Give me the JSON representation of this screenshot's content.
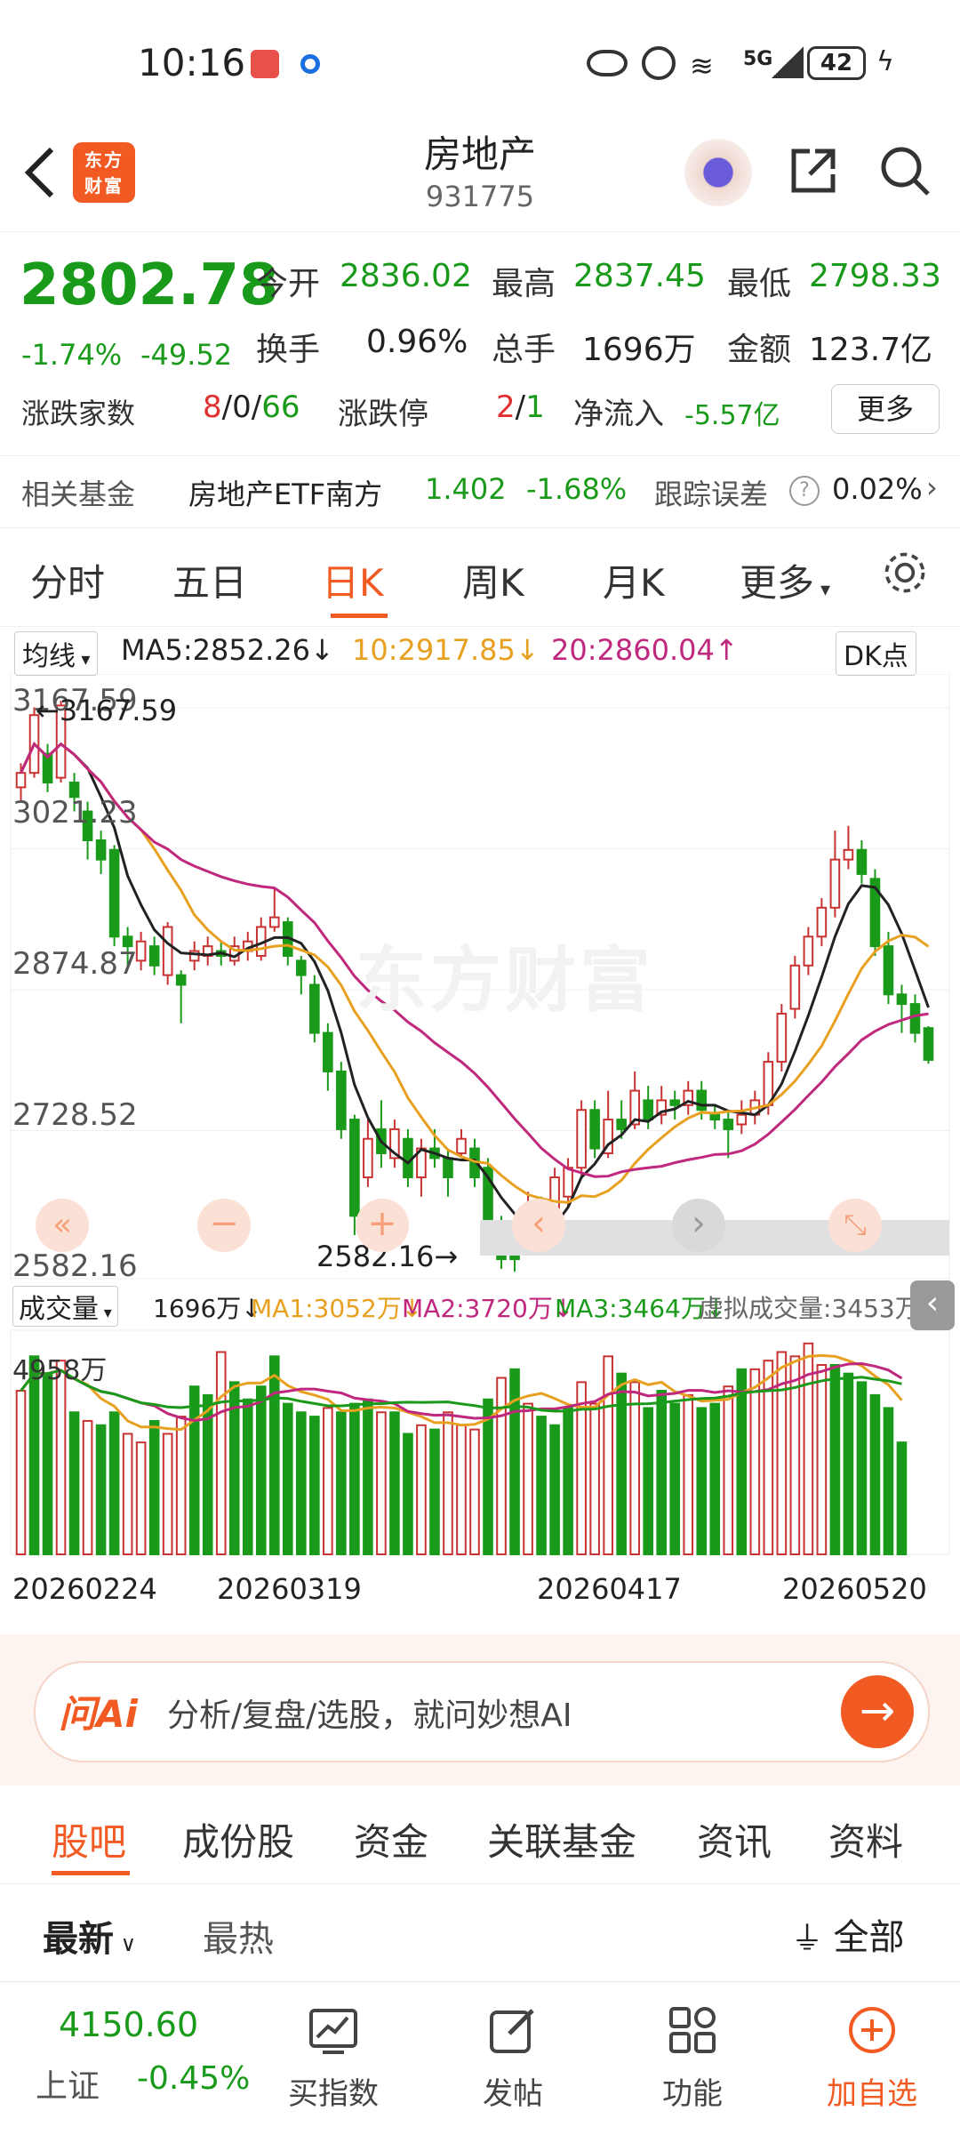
{
  "status": {
    "time": "10:16",
    "battery": "42",
    "network": "5G"
  },
  "header": {
    "title": "房地产",
    "code": "931775",
    "logo": "东方财富"
  },
  "quote": {
    "price": "2802.78",
    "change_pct": "-1.74%",
    "change": "-49.52",
    "open_label": "今开",
    "open": "2836.02",
    "high_label": "最高",
    "high": "2837.45",
    "low_label": "最低",
    "low": "2798.33",
    "turnover_label": "换手",
    "turnover": "0.96%",
    "volume_label": "总手",
    "volume": "1696万",
    "amount_label": "金额",
    "amount": "123.7亿",
    "updown_label": "涨跌家数",
    "up": "8",
    "flat": "0",
    "down": "66",
    "limit_label": "涨跌停",
    "limit_up": "2",
    "limit_down": "1",
    "inflow_label": "净流入",
    "inflow": "-5.57亿",
    "more": "更多"
  },
  "fund": {
    "label": "相关基金",
    "name": "房地产ETF南方",
    "price": "1.402",
    "pct": "-1.68%",
    "err_label": "跟踪误差",
    "err": "0.02%"
  },
  "period_tabs": [
    "分时",
    "五日",
    "日K",
    "周K",
    "月K",
    "更多"
  ],
  "active_period": "日K",
  "ma": {
    "select": "均线",
    "ma5": "MA5:2852.26",
    "ma10": "10:2917.85",
    "ma20": "20:2860.04",
    "dk": "DK点",
    "c5": "#222222",
    "c10": "#e8a020",
    "c20": "#c0287e"
  },
  "chart_data": {
    "type": "candlestick",
    "y_ticks": [
      "3167.59",
      "3021.23",
      "2874.87",
      "2728.52",
      "2582.16"
    ],
    "ylim": [
      2582.16,
      3167.59
    ],
    "max_label": "3167.59",
    "min_label": "2582.16",
    "watermark": "东方财富",
    "candles": [
      {
        "o": 3085,
        "c": 3100,
        "h": 3110,
        "l": 3070
      },
      {
        "o": 3100,
        "c": 3160,
        "h": 3168,
        "l": 3095
      },
      {
        "o": 3120,
        "c": 3090,
        "h": 3130,
        "l": 3080
      },
      {
        "o": 3095,
        "c": 3170,
        "h": 3175,
        "l": 3090
      },
      {
        "o": 3090,
        "c": 3075,
        "h": 3100,
        "l": 3060
      },
      {
        "o": 3060,
        "c": 3030,
        "h": 3070,
        "l": 3010
      },
      {
        "o": 3030,
        "c": 3010,
        "h": 3040,
        "l": 2995
      },
      {
        "o": 3020,
        "c": 2930,
        "h": 3025,
        "l": 2920
      },
      {
        "o": 2930,
        "c": 2920,
        "h": 2940,
        "l": 2900
      },
      {
        "o": 2905,
        "c": 2925,
        "h": 2935,
        "l": 2895
      },
      {
        "o": 2920,
        "c": 2900,
        "h": 2930,
        "l": 2890
      },
      {
        "o": 2890,
        "c": 2940,
        "h": 2945,
        "l": 2880
      },
      {
        "o": 2890,
        "c": 2880,
        "h": 2895,
        "l": 2840
      },
      {
        "o": 2905,
        "c": 2915,
        "h": 2925,
        "l": 2895
      },
      {
        "o": 2910,
        "c": 2920,
        "h": 2930,
        "l": 2900
      },
      {
        "o": 2915,
        "c": 2910,
        "h": 2925,
        "l": 2900
      },
      {
        "o": 2905,
        "c": 2920,
        "h": 2930,
        "l": 2900
      },
      {
        "o": 2915,
        "c": 2925,
        "h": 2935,
        "l": 2905
      },
      {
        "o": 2910,
        "c": 2940,
        "h": 2950,
        "l": 2905
      },
      {
        "o": 2940,
        "c": 2950,
        "h": 2980,
        "l": 2935
      },
      {
        "o": 2945,
        "c": 2910,
        "h": 2950,
        "l": 2900
      },
      {
        "o": 2905,
        "c": 2890,
        "h": 2910,
        "l": 2870
      },
      {
        "o": 2880,
        "c": 2830,
        "h": 2890,
        "l": 2820
      },
      {
        "o": 2830,
        "c": 2790,
        "h": 2840,
        "l": 2770
      },
      {
        "o": 2790,
        "c": 2730,
        "h": 2800,
        "l": 2720
      },
      {
        "o": 2740,
        "c": 2640,
        "h": 2745,
        "l": 2620
      },
      {
        "o": 2680,
        "c": 2720,
        "h": 2740,
        "l": 2670
      },
      {
        "o": 2730,
        "c": 2705,
        "h": 2760,
        "l": 2690
      },
      {
        "o": 2700,
        "c": 2730,
        "h": 2740,
        "l": 2690
      },
      {
        "o": 2720,
        "c": 2680,
        "h": 2730,
        "l": 2670
      },
      {
        "o": 2680,
        "c": 2710,
        "h": 2720,
        "l": 2660
      },
      {
        "o": 2710,
        "c": 2700,
        "h": 2730,
        "l": 2690
      },
      {
        "o": 2700,
        "c": 2680,
        "h": 2710,
        "l": 2660
      },
      {
        "o": 2705,
        "c": 2720,
        "h": 2730,
        "l": 2700
      },
      {
        "o": 2710,
        "c": 2680,
        "h": 2720,
        "l": 2670
      },
      {
        "o": 2690,
        "c": 2620,
        "h": 2700,
        "l": 2610
      },
      {
        "o": 2630,
        "c": 2595,
        "h": 2640,
        "l": 2585
      },
      {
        "o": 2600,
        "c": 2595,
        "h": 2610,
        "l": 2582
      },
      {
        "o": 2620,
        "c": 2640,
        "h": 2665,
        "l": 2610
      },
      {
        "o": 2650,
        "c": 2640,
        "h": 2660,
        "l": 2620
      },
      {
        "o": 2640,
        "c": 2680,
        "h": 2690,
        "l": 2630
      },
      {
        "o": 2660,
        "c": 2690,
        "h": 2700,
        "l": 2650
      },
      {
        "o": 2690,
        "c": 2750,
        "h": 2760,
        "l": 2680
      },
      {
        "o": 2750,
        "c": 2710,
        "h": 2760,
        "l": 2700
      },
      {
        "o": 2705,
        "c": 2740,
        "h": 2770,
        "l": 2700
      },
      {
        "o": 2740,
        "c": 2730,
        "h": 2760,
        "l": 2720
      },
      {
        "o": 2735,
        "c": 2770,
        "h": 2790,
        "l": 2730
      },
      {
        "o": 2760,
        "c": 2740,
        "h": 2775,
        "l": 2730
      },
      {
        "o": 2745,
        "c": 2760,
        "h": 2775,
        "l": 2735
      },
      {
        "o": 2760,
        "c": 2755,
        "h": 2770,
        "l": 2740
      },
      {
        "o": 2755,
        "c": 2770,
        "h": 2780,
        "l": 2745
      },
      {
        "o": 2770,
        "c": 2750,
        "h": 2780,
        "l": 2740
      },
      {
        "o": 2745,
        "c": 2740,
        "h": 2755,
        "l": 2730
      },
      {
        "o": 2740,
        "c": 2730,
        "h": 2750,
        "l": 2700
      },
      {
        "o": 2735,
        "c": 2745,
        "h": 2760,
        "l": 2725
      },
      {
        "o": 2745,
        "c": 2760,
        "h": 2770,
        "l": 2735
      },
      {
        "o": 2755,
        "c": 2800,
        "h": 2810,
        "l": 2745
      },
      {
        "o": 2800,
        "c": 2850,
        "h": 2860,
        "l": 2790
      },
      {
        "o": 2855,
        "c": 2900,
        "h": 2910,
        "l": 2845
      },
      {
        "o": 2900,
        "c": 2930,
        "h": 2940,
        "l": 2890
      },
      {
        "o": 2930,
        "c": 2960,
        "h": 2970,
        "l": 2920
      },
      {
        "o": 2960,
        "c": 3010,
        "h": 3040,
        "l": 2950
      },
      {
        "o": 3010,
        "c": 3020,
        "h": 3045,
        "l": 3000
      },
      {
        "o": 3020,
        "c": 2995,
        "h": 3030,
        "l": 2985
      },
      {
        "o": 2990,
        "c": 2920,
        "h": 3000,
        "l": 2910
      },
      {
        "o": 2920,
        "c": 2870,
        "h": 2935,
        "l": 2860
      },
      {
        "o": 2870,
        "c": 2860,
        "h": 2880,
        "l": 2830
      },
      {
        "o": 2860,
        "c": 2830,
        "h": 2870,
        "l": 2820
      },
      {
        "o": 2835,
        "c": 2802,
        "h": 2837,
        "l": 2798
      }
    ],
    "volume": [
      {
        "v": 3800,
        "up": true
      },
      {
        "v": 4600,
        "up": false
      },
      {
        "v": 4200,
        "up": false
      },
      {
        "v": 4500,
        "up": true
      },
      {
        "v": 3300,
        "up": false
      },
      {
        "v": 3100,
        "up": true
      },
      {
        "v": 3000,
        "up": false
      },
      {
        "v": 3300,
        "up": false
      },
      {
        "v": 2800,
        "up": true
      },
      {
        "v": 2600,
        "up": true
      },
      {
        "v": 3100,
        "up": false
      },
      {
        "v": 2800,
        "up": true
      },
      {
        "v": 3200,
        "up": true
      },
      {
        "v": 3900,
        "up": false
      },
      {
        "v": 3700,
        "up": false
      },
      {
        "v": 4700,
        "up": true
      },
      {
        "v": 4000,
        "up": false
      },
      {
        "v": 3600,
        "up": false
      },
      {
        "v": 3900,
        "up": false
      },
      {
        "v": 4600,
        "up": false
      },
      {
        "v": 3500,
        "up": false
      },
      {
        "v": 3300,
        "up": false
      },
      {
        "v": 3200,
        "up": false
      },
      {
        "v": 3400,
        "up": true
      },
      {
        "v": 3300,
        "up": false
      },
      {
        "v": 3500,
        "up": false
      },
      {
        "v": 3600,
        "up": false
      },
      {
        "v": 3300,
        "up": true
      },
      {
        "v": 3300,
        "up": false
      },
      {
        "v": 2800,
        "up": false
      },
      {
        "v": 3000,
        "up": true
      },
      {
        "v": 2900,
        "up": false
      },
      {
        "v": 3300,
        "up": true
      },
      {
        "v": 3000,
        "up": true
      },
      {
        "v": 2900,
        "up": true
      },
      {
        "v": 3600,
        "up": false
      },
      {
        "v": 4100,
        "up": true
      },
      {
        "v": 4300,
        "up": false
      },
      {
        "v": 3500,
        "up": true
      },
      {
        "v": 3200,
        "up": false
      },
      {
        "v": 3000,
        "up": false
      },
      {
        "v": 3400,
        "up": false
      },
      {
        "v": 4000,
        "up": true
      },
      {
        "v": 3500,
        "up": true
      },
      {
        "v": 4600,
        "up": true
      },
      {
        "v": 4200,
        "up": false
      },
      {
        "v": 4000,
        "up": true
      },
      {
        "v": 3400,
        "up": false
      },
      {
        "v": 3800,
        "up": false
      },
      {
        "v": 3500,
        "up": false
      },
      {
        "v": 3700,
        "up": true
      },
      {
        "v": 3400,
        "up": false
      },
      {
        "v": 3500,
        "up": false
      },
      {
        "v": 3900,
        "up": true
      },
      {
        "v": 4300,
        "up": false
      },
      {
        "v": 4300,
        "up": true
      },
      {
        "v": 4500,
        "up": true
      },
      {
        "v": 4700,
        "up": true
      },
      {
        "v": 4600,
        "up": true
      },
      {
        "v": 4900,
        "up": true
      },
      {
        "v": 4400,
        "up": true
      },
      {
        "v": 4400,
        "up": false
      },
      {
        "v": 4200,
        "up": false
      },
      {
        "v": 4000,
        "up": false
      },
      {
        "v": 3700,
        "up": false
      },
      {
        "v": 3400,
        "up": false
      },
      {
        "v": 2600,
        "up": false
      }
    ],
    "vol_max_label": "4958万",
    "vol_legend": {
      "select": "成交量",
      "vol": "1696万",
      "ma1": "MA1:3052万",
      "ma2": "MA2:3720万",
      "ma3": "MA3:3464万",
      "virtual": "虚拟成交量:3453万"
    },
    "dates": [
      "20260224",
      "20260319",
      "20260417",
      "20260520"
    ]
  },
  "ai": {
    "logo": "问Ai",
    "placeholder": "分析/复盘/选股，就问妙想AI"
  },
  "bottom_tabs": [
    "股吧",
    "成份股",
    "资金",
    "关联基金",
    "资讯",
    "资料"
  ],
  "filter": {
    "latest": "最新",
    "hot": "最热",
    "all": "全部"
  },
  "nav": {
    "index_price": "4150.60",
    "index_name": "上证",
    "index_pct": "-0.45%",
    "items": [
      "买指数",
      "发帖",
      "功能",
      "加自选"
    ]
  }
}
